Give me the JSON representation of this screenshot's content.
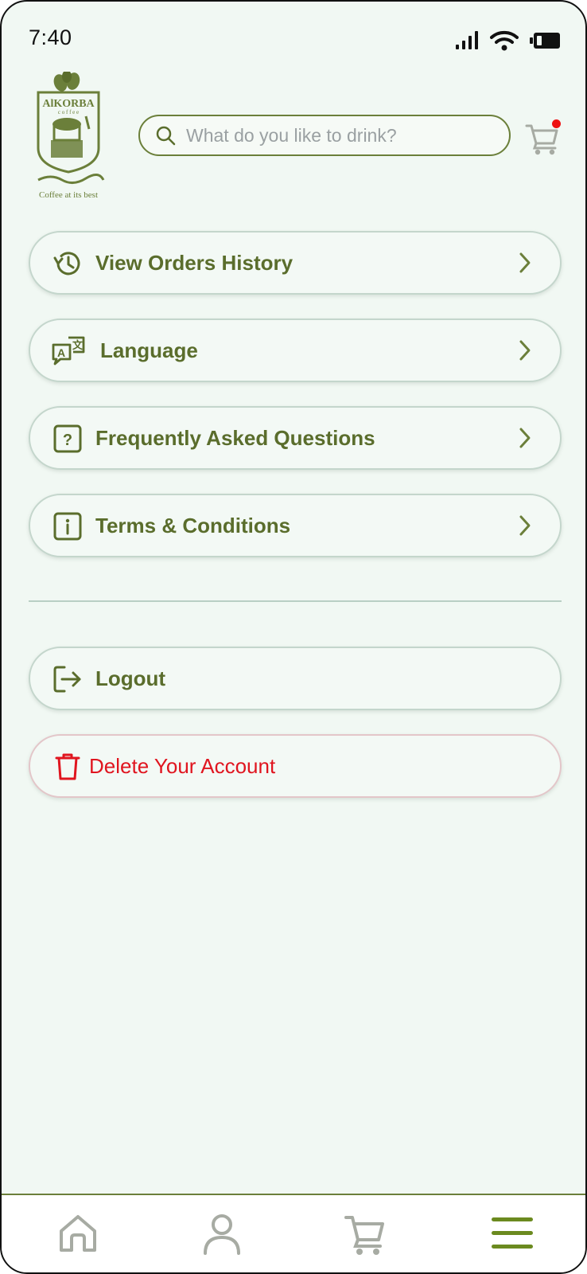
{
  "status_bar": {
    "time": "7:40",
    "icons": [
      "signal-icon",
      "wifi-icon",
      "battery-icon"
    ]
  },
  "header": {
    "logo_alt": "AlKORBA coffee - Coffee at its best",
    "search": {
      "placeholder": "What do you like to drink?"
    },
    "cart_has_badge": true
  },
  "menu": {
    "items": [
      {
        "label": "View Orders History",
        "icon": "history-icon"
      },
      {
        "label": "Language",
        "icon": "translate-icon"
      },
      {
        "label": "Frequently Asked Questions",
        "icon": "question-icon"
      },
      {
        "label": "Terms & Conditions",
        "icon": "info-icon"
      }
    ]
  },
  "account": {
    "logout_label": "Logout",
    "delete_label": "Delete Your Account"
  },
  "bottom_nav": {
    "items": [
      {
        "name": "home",
        "icon": "home-icon"
      },
      {
        "name": "profile",
        "icon": "user-icon"
      },
      {
        "name": "cart",
        "icon": "cart-icon"
      },
      {
        "name": "menu",
        "icon": "hamburger-icon",
        "active": true
      }
    ]
  },
  "colors": {
    "brand_green": "#5a6d2c",
    "accent_olive": "#6b7f3a",
    "background": "#f1f8f3",
    "danger": "#e0151f",
    "inactive_gray": "#a7aba3"
  }
}
